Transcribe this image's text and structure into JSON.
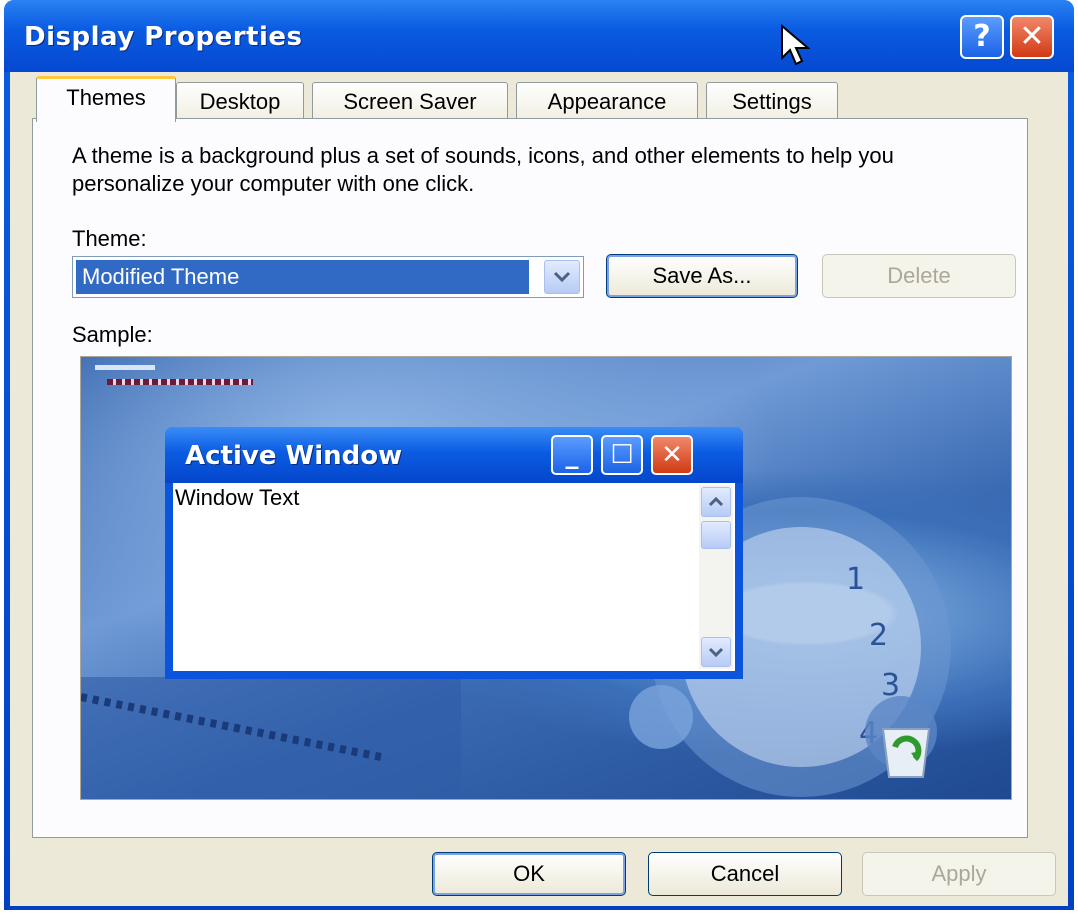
{
  "window": {
    "title": "Display Properties",
    "help_glyph": "?",
    "close_glyph": "✕"
  },
  "tabs": [
    {
      "label": "Themes",
      "active": true
    },
    {
      "label": "Desktop",
      "active": false
    },
    {
      "label": "Screen Saver",
      "active": false
    },
    {
      "label": "Appearance",
      "active": false
    },
    {
      "label": "Settings",
      "active": false
    }
  ],
  "themes_tab": {
    "description": "A theme is a background plus a set of sounds, icons, and other elements to help you personalize your computer with one click.",
    "theme_label": "Theme:",
    "theme_value": "Modified Theme",
    "save_as_label": "Save As...",
    "delete_label": "Delete",
    "sample_label": "Sample:"
  },
  "sample": {
    "active_window_title": "Active Window",
    "window_text": "Window Text",
    "minimize_glyph": "_",
    "maximize_glyph": "☐",
    "close_glyph": "✕"
  },
  "footer": {
    "ok_label": "OK",
    "cancel_label": "Cancel",
    "apply_label": "Apply"
  },
  "colors": {
    "xp_blue": "#0b5ce2",
    "panel": "#ece9d8",
    "selection": "#316ac5",
    "close_red": "#d23a14"
  }
}
